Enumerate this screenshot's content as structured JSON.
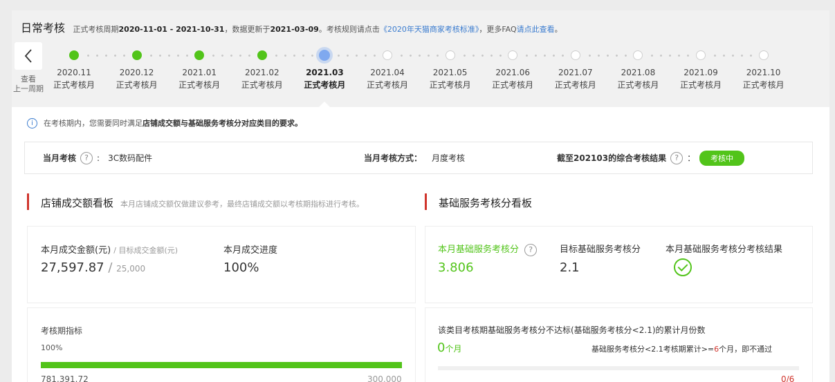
{
  "header": {
    "title": "日常考核",
    "period_prefix": "正式考核周期",
    "period": "2020-11-01 - 2021-10-31",
    "update_prefix": "，数据更新于",
    "update_date": "2021-03-09",
    "rules_prefix": "。考核规则请点击",
    "rules_link": "《2020年天猫商家考核标准》",
    "faq_prefix": "，更多FAQ",
    "faq_link": "请点此查看",
    "faq_suffix": "。",
    "prev_label_line1": "查看",
    "prev_label_line2": "上一周期"
  },
  "timeline": [
    {
      "month": "2020.11",
      "label": "正式考核月",
      "status": "done"
    },
    {
      "month": "2020.12",
      "label": "正式考核月",
      "status": "done"
    },
    {
      "month": "2021.01",
      "label": "正式考核月",
      "status": "done"
    },
    {
      "month": "2021.02",
      "label": "正式考核月",
      "status": "done"
    },
    {
      "month": "2021.03",
      "label": "正式考核月",
      "status": "current"
    },
    {
      "month": "2021.04",
      "label": "正式考核月",
      "status": "todo"
    },
    {
      "month": "2021.05",
      "label": "正式考核月",
      "status": "todo"
    },
    {
      "month": "2021.06",
      "label": "正式考核月",
      "status": "todo"
    },
    {
      "month": "2021.07",
      "label": "正式考核月",
      "status": "todo"
    },
    {
      "month": "2021.08",
      "label": "正式考核月",
      "status": "todo"
    },
    {
      "month": "2021.09",
      "label": "正式考核月",
      "status": "todo"
    },
    {
      "month": "2021.10",
      "label": "正式考核月",
      "status": "todo"
    }
  ],
  "notice": {
    "prefix": "在考核期内，您需要同时满足",
    "bold": "店铺成交额与基础服务考核分对应类目的要求。"
  },
  "summary": {
    "category_label": "当月考核",
    "category_value": "3C数码配件",
    "method_label": "当月考核方式：",
    "method_value": "月度考核",
    "result_label": "截至202103的综合考核结果",
    "result_colon": "：",
    "status": "考核中"
  },
  "sales": {
    "title": "店铺成交额看板",
    "subtitle": "本月店铺成交额仅做建议参考，最终店铺成交额以考核期指标进行考核。",
    "amount_label": "本月成交金额(元)",
    "target_label": "/ 目标成交金额(元)",
    "amount_value": "27,597.87",
    "target_value": "25,000",
    "progress_label": "本月成交进度",
    "progress_value": "100%",
    "period_label": "考核期指标",
    "period_pct": "100%",
    "period_progress": 1.0,
    "period_value": "781,391.72",
    "period_target": "300,000"
  },
  "service": {
    "title": "基础服务考核分看板",
    "score_label": "本月基础服务考核分",
    "score_value": "3.806",
    "target_label": "目标基础服务考核分",
    "target_value": "2.1",
    "result_label": "本月基础服务考核分考核结果",
    "fail_title": "该类目考核期基础服务考核分不达标(基础服务考核分<2.1)的累计月份数",
    "fail_count": "0",
    "fail_unit": "个月",
    "rule_prefix": "基础服务考核分<2.1考核期累计>=",
    "rule_num": "6",
    "rule_suffix": "个月，即不通过",
    "ratio": "0/6"
  },
  "colors": {
    "accent_green": "#52c41a",
    "accent_red": "#d0342c",
    "link_blue": "#3b7ccf"
  }
}
